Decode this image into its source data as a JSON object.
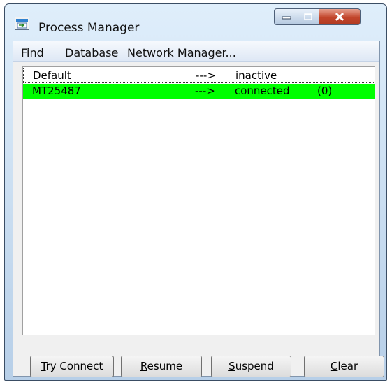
{
  "window": {
    "title": "Process Manager",
    "title_icon": "process-manager-icon"
  },
  "titlebar_buttons": [
    {
      "name": "minimize",
      "icon": "minimize-icon"
    },
    {
      "name": "maximize",
      "icon": "maximize-icon"
    },
    {
      "name": "close",
      "icon": "close-icon"
    }
  ],
  "menu": [
    {
      "label": "Find"
    },
    {
      "label": "Database"
    },
    {
      "label": "Network Manager..."
    }
  ],
  "list": {
    "rows": [
      {
        "name": "Default",
        "arrow": "--->",
        "state": "inactive",
        "count": ""
      },
      {
        "name": "MT25487",
        "arrow": "--->",
        "state": "connected",
        "count": "(0)"
      }
    ],
    "highlight_color": "#00ff00"
  },
  "buttons": {
    "try_connect": {
      "mnemonic": "T",
      "rest": "ry Connect"
    },
    "resume": {
      "mnemonic": "R",
      "rest": "esume"
    },
    "suspend": {
      "mnemonic": "S",
      "rest": "uspend"
    },
    "clear": {
      "mnemonic": "C",
      "rest": "lear"
    }
  }
}
